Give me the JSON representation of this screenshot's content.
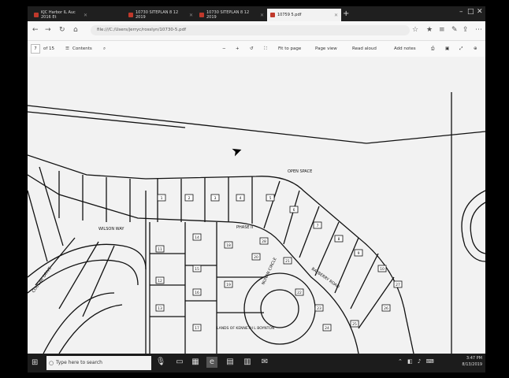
{
  "tabs": [
    {
      "label": "KJC Harbor IL Auc 2016 Et",
      "active": false
    },
    {
      "label": "10730 SITEPLAN 8 12 2019",
      "active": false
    },
    {
      "label": "10730 SITEPLAN 8 12 2019",
      "active": false
    },
    {
      "label": "10759 5.pdf",
      "active": true
    }
  ],
  "address": {
    "url": "file:///C:/Users/jerryc/rosslyn/10730-5.pdf"
  },
  "pdf_toolbar": {
    "page_current": "7",
    "page_total": "of 15",
    "contents_label": "Contents",
    "fit_label": "Fit to page",
    "page_view_label": "Page view",
    "read_aloud_label": "Read aloud",
    "add_notes_label": "Add notes"
  },
  "plan": {
    "open_space": "OPEN SPACE",
    "wilson_way": "WILSON WAY",
    "phase_ii": "PHASE II",
    "bayberry_road": "BAYBERRY ROAD",
    "cougar_drive": "COUGAR DRIVE",
    "nunan_circle": "NUNAN CIRCLE",
    "kenneth": "LANDS OF KENNETH L BOYNTON",
    "lot_numbers": [
      "1",
      "2",
      "3",
      "4",
      "5",
      "6",
      "7",
      "8",
      "9",
      "10",
      "11",
      "12",
      "13",
      "14",
      "15",
      "16",
      "17",
      "18",
      "19",
      "20",
      "21",
      "22",
      "23",
      "24",
      "25",
      "26",
      "27",
      "28"
    ]
  },
  "taskbar": {
    "search_placeholder": "Type here to search",
    "time": "3:47 PM",
    "date": "8/13/2019"
  }
}
